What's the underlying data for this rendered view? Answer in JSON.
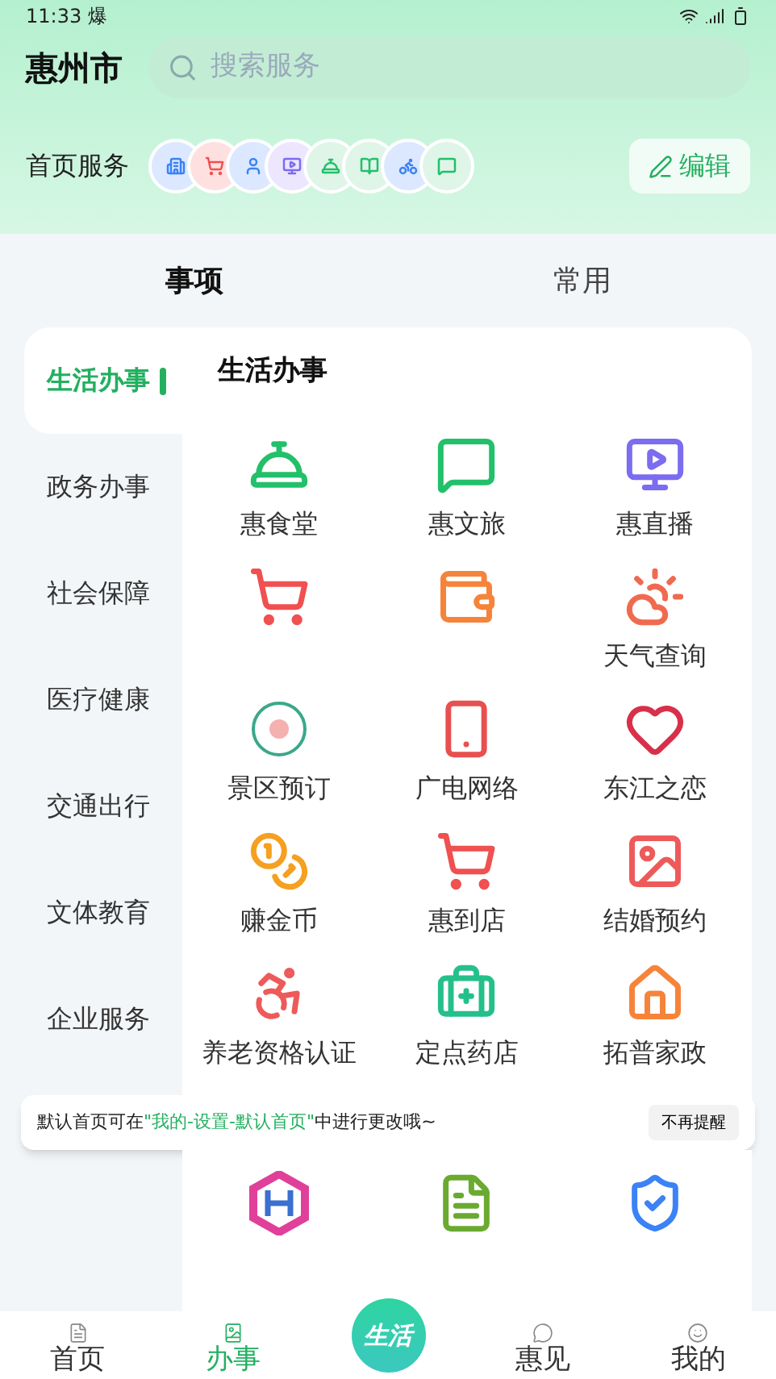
{
  "status_bar": {
    "time": "11:33",
    "notice": "爆"
  },
  "header": {
    "city": "惠州市",
    "search": {
      "placeholder": "搜索服务"
    },
    "home_services_label": "首页服务",
    "edit_button": "编辑"
  },
  "tabs": [
    {
      "label": "事项",
      "selected": true
    },
    {
      "label": "常用",
      "selected": false
    }
  ],
  "sidebar": {
    "items": [
      {
        "label": "生活办事",
        "selected": true
      },
      {
        "label": "政务办事",
        "selected": false
      },
      {
        "label": "社会保障",
        "selected": false
      },
      {
        "label": "医疗健康",
        "selected": false
      },
      {
        "label": "交通出行",
        "selected": false
      },
      {
        "label": "文体教育",
        "selected": false
      },
      {
        "label": "企业服务",
        "selected": false
      }
    ]
  },
  "section": {
    "title": "生活办事",
    "services": [
      {
        "kind": "labeled",
        "label": "惠食堂"
      },
      {
        "kind": "labeled",
        "label": "惠文旅"
      },
      {
        "kind": "labeled",
        "label": "惠直播"
      },
      {
        "kind": "icon_only"
      },
      {
        "kind": "icon_only"
      },
      {
        "kind": "labeled",
        "label": "天气查询"
      },
      {
        "kind": "labeled",
        "label": "景区预订"
      },
      {
        "kind": "labeled",
        "label": "广电网络"
      },
      {
        "kind": "labeled",
        "label": "东江之恋"
      },
      {
        "kind": "labeled",
        "label": "赚金币"
      },
      {
        "kind": "labeled",
        "label": "惠到店"
      },
      {
        "kind": "labeled",
        "label": "结婚预约"
      },
      {
        "kind": "labeled",
        "label": "养老资格认证"
      },
      {
        "kind": "labeled",
        "label": "定点药店"
      },
      {
        "kind": "labeled",
        "label": "拓普家政"
      },
      {
        "kind": "icon_only"
      },
      {
        "kind": "icon_only"
      },
      {
        "kind": "icon_only"
      }
    ]
  },
  "toast": {
    "text_before": "默认首页可在",
    "highlight": "\"我的-设置-默认首页\"",
    "text_after": "中进行更改哦~",
    "dismiss_button": "不再提醒"
  },
  "bottom_nav": [
    {
      "label": "首页",
      "selected": false
    },
    {
      "label": "办事",
      "selected": true
    },
    {
      "label": "生活",
      "kind": "center"
    },
    {
      "label": "惠见",
      "selected": false
    },
    {
      "label": "我的",
      "selected": false
    }
  ]
}
